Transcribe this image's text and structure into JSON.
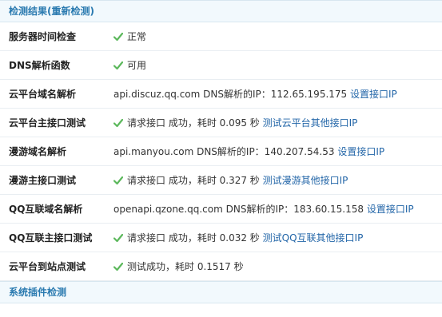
{
  "sections": {
    "result_title": "检测结果(重新检测)",
    "plugin_title": "系统插件检测"
  },
  "rows": [
    {
      "label": "服务器时间检查",
      "status": "正常"
    },
    {
      "label": "DNS解析函数",
      "status": "可用"
    },
    {
      "label": "云平台域名解析",
      "text": "api.discuz.qq.com DNS解析的IP：112.65.195.175",
      "link": "设置接口IP"
    },
    {
      "label": "云平台主接口测试",
      "text": "请求接口 成功，耗时 0.095 秒",
      "link": "测试云平台其他接口IP"
    },
    {
      "label": "漫游域名解析",
      "text": "api.manyou.com DNS解析的IP：140.207.54.53",
      "link": "设置接口IP"
    },
    {
      "label": "漫游主接口测试",
      "text": "请求接口 成功，耗时 0.327 秒",
      "link": "测试漫游其他接口IP"
    },
    {
      "label": "QQ互联域名解析",
      "text": "openapi.qzone.qq.com DNS解析的IP：183.60.15.158",
      "link": "设置接口IP"
    },
    {
      "label": "QQ互联主接口测试",
      "text": "请求接口 成功，耗时 0.032 秒",
      "link": "测试QQ互联其他接口IP"
    },
    {
      "label": "云平台到站点测试",
      "text": "测试成功，耗时 0.1517 秒"
    }
  ],
  "colors": {
    "header_bg": "#f2f9fd",
    "header_text": "#2a7ab0",
    "link": "#2366a8",
    "check": "#5cb85c"
  },
  "icons": {
    "status": "check-icon"
  }
}
